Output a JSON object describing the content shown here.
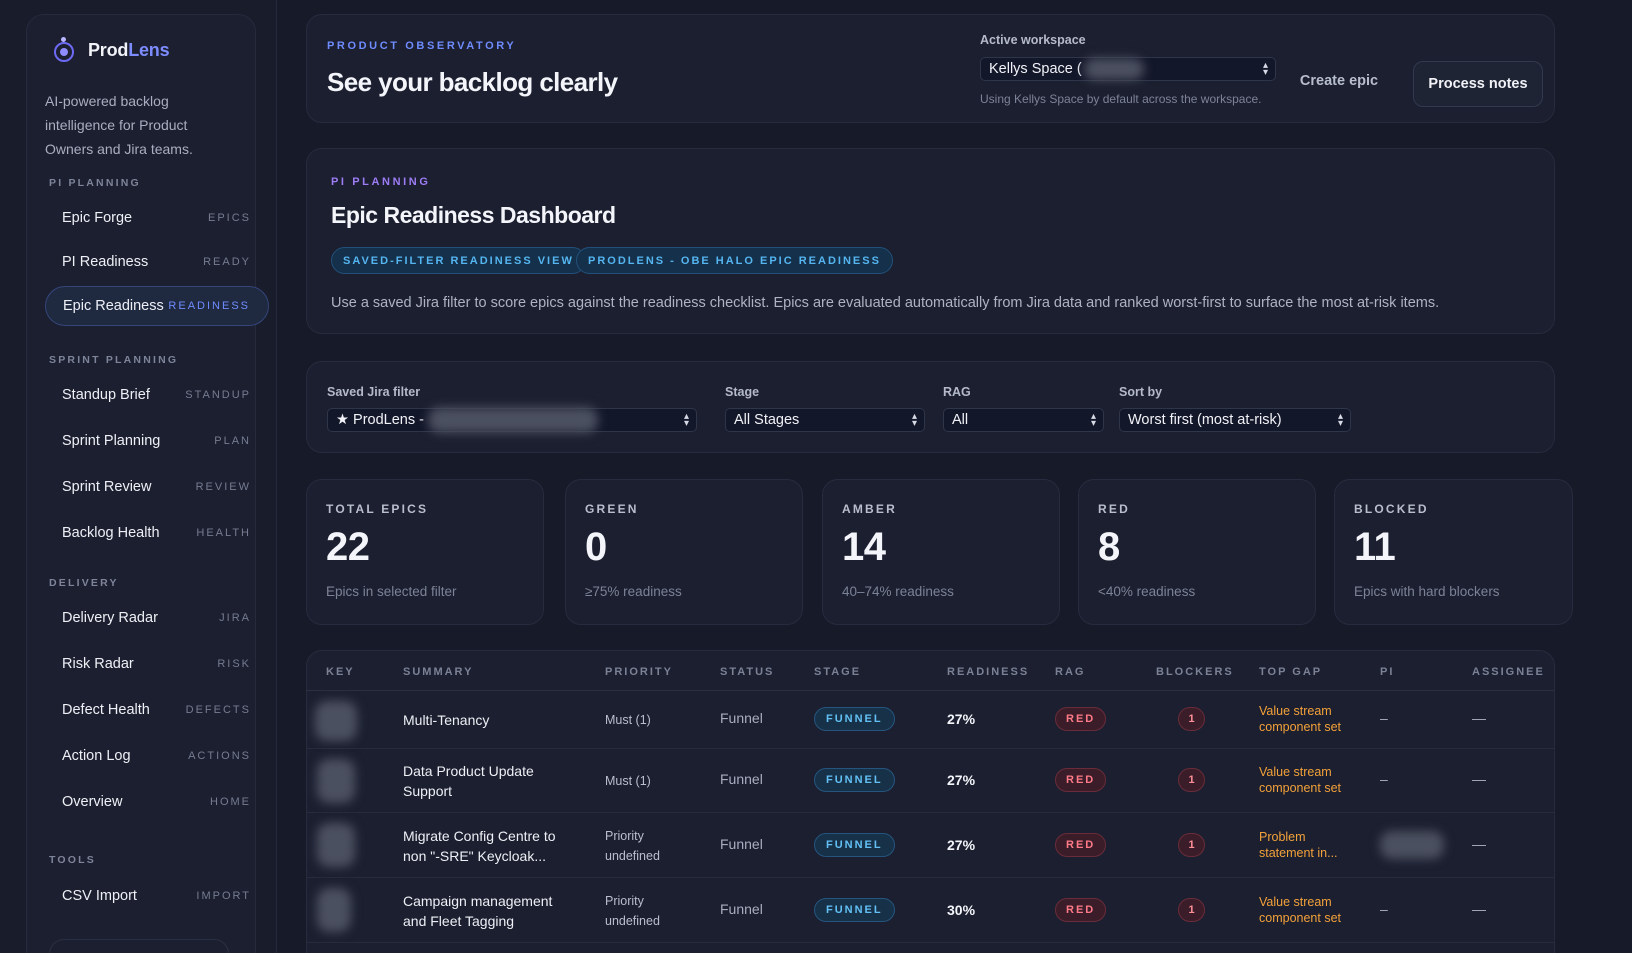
{
  "brand": {
    "name_part1": "Prod",
    "name_part2": "Lens",
    "tagline": "AI-powered backlog intelligence for Product Owners and Jira teams."
  },
  "sidebar": {
    "sections": [
      {
        "title": "PI PLANNING",
        "items": [
          {
            "label": "Epic Forge",
            "tag": "EPICS"
          },
          {
            "label": "PI Readiness",
            "tag": "READY"
          },
          {
            "label": "Epic Readiness",
            "tag": "READINESS",
            "active": true
          }
        ]
      },
      {
        "title": "SPRINT PLANNING",
        "items": [
          {
            "label": "Standup Brief",
            "tag": "STANDUP"
          },
          {
            "label": "Sprint Planning",
            "tag": "PLAN"
          },
          {
            "label": "Sprint Review",
            "tag": "REVIEW"
          },
          {
            "label": "Backlog Health",
            "tag": "HEALTH"
          }
        ]
      },
      {
        "title": "DELIVERY",
        "items": [
          {
            "label": "Delivery Radar",
            "tag": "JIRA"
          },
          {
            "label": "Risk Radar",
            "tag": "RISK"
          },
          {
            "label": "Defect Health",
            "tag": "DEFECTS"
          },
          {
            "label": "Action Log",
            "tag": "ACTIONS"
          },
          {
            "label": "Overview",
            "tag": "HOME"
          }
        ]
      },
      {
        "title": "TOOLS",
        "items": [
          {
            "label": "CSV Import",
            "tag": "IMPORT"
          }
        ]
      }
    ]
  },
  "header": {
    "eyebrow": "PRODUCT OBSERVATORY",
    "title": "See your backlog clearly",
    "workspace_label": "Active workspace",
    "workspace_value": "Kellys Space (",
    "workspace_hint": "Using Kellys Space by default across the workspace.",
    "create_label": "Create epic",
    "process_label": "Process notes"
  },
  "intro": {
    "eyebrow": "PI PLANNING",
    "title": "Epic Readiness Dashboard",
    "chips": [
      "SAVED-FILTER READINESS VIEW",
      "PRODLENS - OBE HALO EPIC READINESS"
    ],
    "description": "Use a saved Jira filter to score epics against the readiness checklist. Epics are evaluated automatically from Jira data and ranked worst-first to surface the most at-risk items."
  },
  "filters": {
    "saved_label": "Saved Jira filter",
    "saved_value": "★ ProdLens - ",
    "stage_label": "Stage",
    "stage_value": "All Stages",
    "rag_label": "RAG",
    "rag_value": "All",
    "sort_label": "Sort by",
    "sort_value": "Worst first (most at-risk)"
  },
  "stats": [
    {
      "label": "TOTAL EPICS",
      "value": "22",
      "sub": "Epics in selected filter"
    },
    {
      "label": "GREEN",
      "value": "0",
      "sub": "≥75% readiness"
    },
    {
      "label": "AMBER",
      "value": "14",
      "sub": "40–74% readiness"
    },
    {
      "label": "RED",
      "value": "8",
      "sub": "<40% readiness"
    },
    {
      "label": "BLOCKED",
      "value": "11",
      "sub": "Epics with hard blockers"
    }
  ],
  "table": {
    "headers": [
      "KEY",
      "SUMMARY",
      "PRIORITY",
      "STATUS",
      "STAGE",
      "READINESS",
      "RAG",
      "BLOCKERS",
      "TOP GAP",
      "PI",
      "ASSIGNEE"
    ],
    "rows": [
      {
        "summary": [
          "Multi-Tenancy"
        ],
        "priority": [
          "Must (1)"
        ],
        "status": "Funnel",
        "stage": "FUNNEL",
        "readiness": "27%",
        "rag": "RED",
        "blockers": "1",
        "gap": [
          "Value stream",
          "component set"
        ],
        "pi": "–",
        "assignee": "—"
      },
      {
        "summary": [
          "Data Product Update",
          "Support"
        ],
        "priority": [
          "Must (1)"
        ],
        "status": "Funnel",
        "stage": "FUNNEL",
        "readiness": "27%",
        "rag": "RED",
        "blockers": "1",
        "gap": [
          "Value stream",
          "component set"
        ],
        "pi": "–",
        "assignee": "—"
      },
      {
        "summary": [
          "Migrate Config Centre to",
          "non \"-SRE\" Keycloak..."
        ],
        "priority": [
          "Priority",
          "undefined"
        ],
        "status": "Funnel",
        "stage": "FUNNEL",
        "readiness": "27%",
        "rag": "RED",
        "blockers": "1",
        "gap": [
          "Problem",
          "statement in..."
        ],
        "pi": "",
        "assignee": "—"
      },
      {
        "summary": [
          "Campaign management",
          "and Fleet Tagging"
        ],
        "priority": [
          "Priority",
          "undefined"
        ],
        "status": "Funnel",
        "stage": "FUNNEL",
        "readiness": "30%",
        "rag": "RED",
        "blockers": "1",
        "gap": [
          "Value stream",
          "component set"
        ],
        "pi": "–",
        "assignee": "—"
      }
    ]
  }
}
